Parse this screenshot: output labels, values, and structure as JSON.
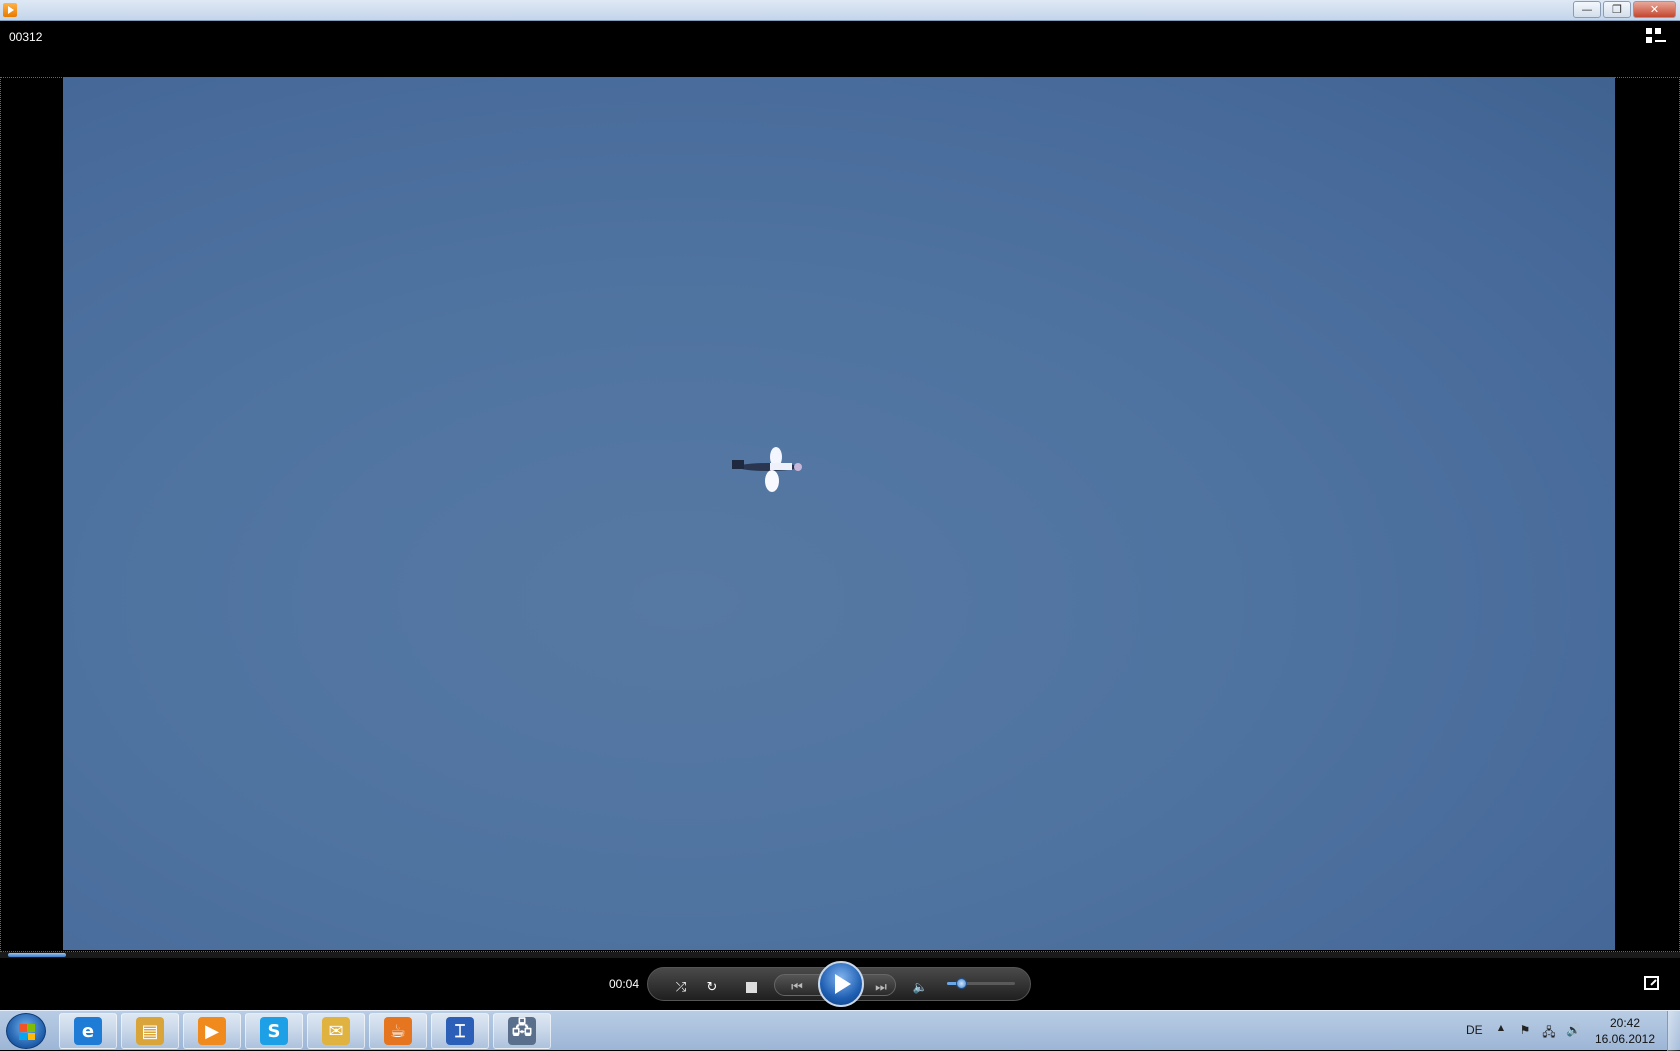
{
  "window": {
    "minimize_glyph": "—",
    "restore_glyph": "❐",
    "close_glyph": "✕"
  },
  "header": {
    "file_title": "00312"
  },
  "playback": {
    "elapsed": "00:04",
    "seek_progress_fraction": 0.035,
    "volume_fraction": 0.2,
    "shuffle_glyph": "⤮",
    "repeat_glyph": "↻",
    "prev_glyph": "⏮",
    "next_glyph": "⏭",
    "mute_glyph": "🔈"
  },
  "taskbar": {
    "items": [
      {
        "name": "internet-explorer",
        "glyph": "e",
        "color": "#1e7bd6"
      },
      {
        "name": "file-explorer",
        "glyph": "▤",
        "color": "#d9a53b"
      },
      {
        "name": "media-player",
        "glyph": "▶",
        "color": "#f08a1c"
      },
      {
        "name": "skype",
        "glyph": "S",
        "color": "#1ea0e6"
      },
      {
        "name": "mail",
        "glyph": "✉",
        "color": "#e0b340"
      },
      {
        "name": "java",
        "glyph": "☕",
        "color": "#e5761f"
      },
      {
        "name": "tool-app",
        "glyph": "⌶",
        "color": "#2b5fb8"
      },
      {
        "name": "network-app",
        "glyph": "🖧",
        "color": "#5a6f8c"
      }
    ],
    "language": "DE",
    "tray_up_glyph": "▲",
    "flag_glyph": "⚑",
    "network_glyph": "🖧",
    "volume_glyph": "🔊",
    "time": "20:42",
    "date": "16.06.2012"
  }
}
